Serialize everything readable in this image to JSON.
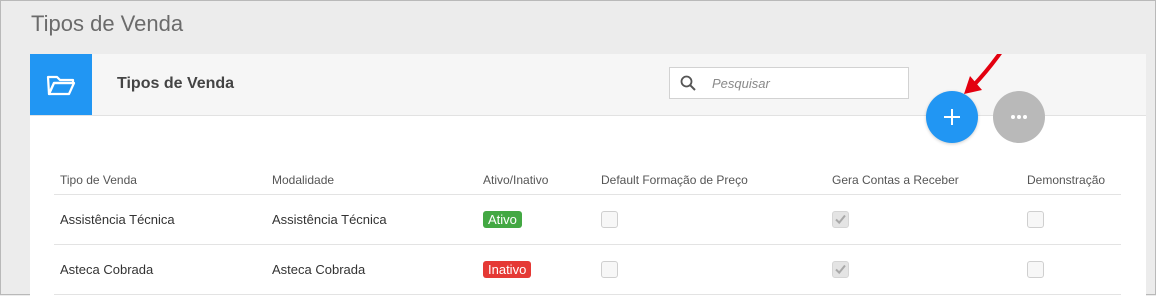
{
  "page": {
    "title": "Tipos de Venda"
  },
  "panel": {
    "title": "Tipos de Venda"
  },
  "search": {
    "placeholder": "Pesquisar",
    "value": ""
  },
  "actions": {
    "add_icon": "plus-icon",
    "more_icon": "ellipsis-icon"
  },
  "colors": {
    "primary": "#2196f3",
    "active_badge": "#43a843",
    "inactive_badge": "#e53935",
    "link": "#2b86d3",
    "arrow": "#e3000f"
  },
  "table": {
    "headers": [
      "Tipo de Venda",
      "Modalidade",
      "Ativo/Inativo",
      "Default Formação de Preço",
      "Gera Contas a Receber",
      "Demonstração"
    ],
    "rows": [
      {
        "tipo": "Assistência Técnica",
        "modalidade": "Assistência Técnica",
        "status": "Ativo",
        "default_formacao": false,
        "gera_contas": true,
        "demonstracao": false
      },
      {
        "tipo": "Asteca Cobrada",
        "modalidade": "Asteca Cobrada",
        "status": "Inativo",
        "default_formacao": false,
        "gera_contas": true,
        "demonstracao": false
      }
    ]
  }
}
